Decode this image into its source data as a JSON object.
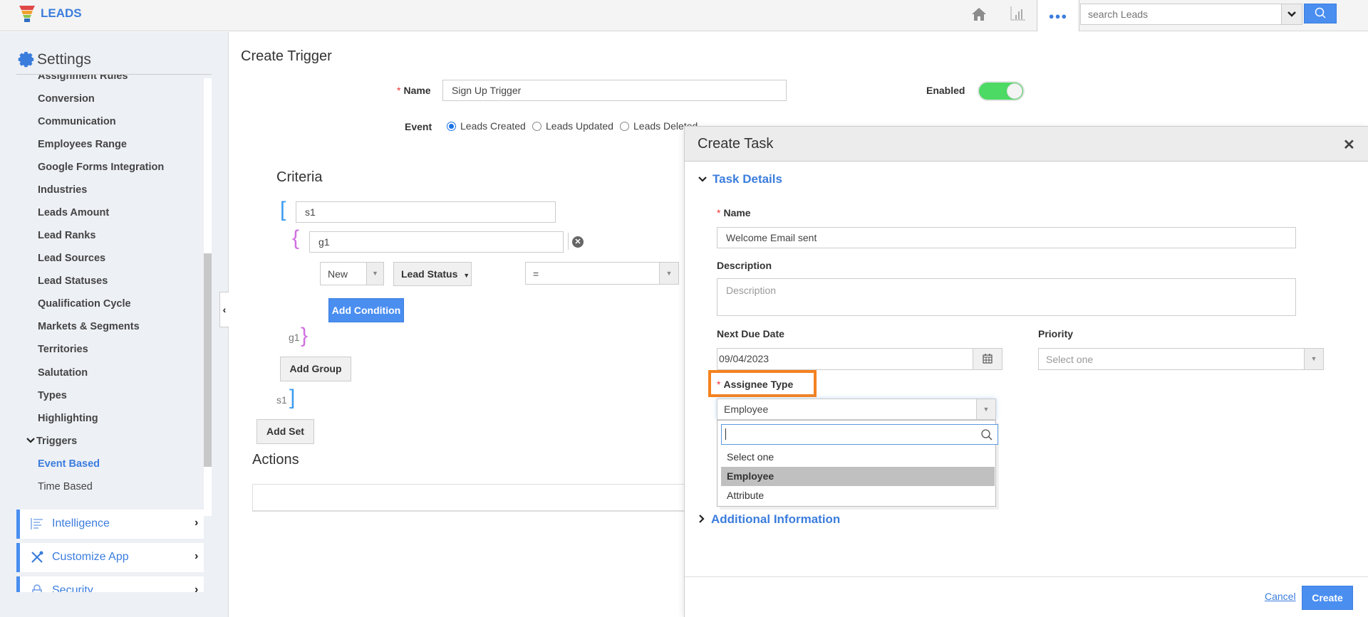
{
  "app": {
    "name": "LEADS",
    "search_placeholder": "search Leads"
  },
  "topbar": {
    "icons": [
      "home-icon",
      "reports-chart-icon",
      "more-dots-icon",
      "search-icon"
    ],
    "more_label": "●●●"
  },
  "sidebar": {
    "title": "Settings",
    "items": [
      {
        "label": "Assignment Rules"
      },
      {
        "label": "Conversion"
      },
      {
        "label": "Communication"
      },
      {
        "label": "Employees Range"
      },
      {
        "label": "Google Forms Integration"
      },
      {
        "label": "Industries"
      },
      {
        "label": "Leads Amount"
      },
      {
        "label": "Lead Ranks"
      },
      {
        "label": "Lead Sources"
      },
      {
        "label": "Lead Statuses"
      },
      {
        "label": "Qualification Cycle"
      },
      {
        "label": "Markets & Segments"
      },
      {
        "label": "Territories"
      },
      {
        "label": "Salutation"
      },
      {
        "label": "Types"
      },
      {
        "label": "Highlighting"
      },
      {
        "label": "Triggers",
        "expanded": true
      },
      {
        "label": "Event Based",
        "active": true
      },
      {
        "label": "Time Based"
      }
    ],
    "groups": [
      {
        "label": "Intelligence",
        "icon": "intelligence-icon"
      },
      {
        "label": "Customize App",
        "icon": "tools-icon"
      },
      {
        "label": "Security",
        "icon": "lock-icon"
      }
    ],
    "collapse_glyph": "‹"
  },
  "trigger_form": {
    "title": "Create Trigger",
    "name_label": "Name",
    "name_value": "Sign Up Trigger",
    "enabled_label": "Enabled",
    "enabled": true,
    "event_label": "Event",
    "events": [
      {
        "label": "Leads Created",
        "selected": true
      },
      {
        "label": "Leads Updated",
        "selected": false
      },
      {
        "label": "Leads Deleted",
        "selected": false
      }
    ],
    "criteria": {
      "title": "Criteria",
      "set_name": "s1",
      "group_name": "g1",
      "condition": {
        "value": "New",
        "field": "Lead Status",
        "operator": "="
      },
      "add_condition_label": "Add Condition",
      "add_group_label": "Add Group",
      "add_set_label": "Add Set",
      "set_close_label": "s1",
      "group_close_label": "g1"
    },
    "actions_title": "Actions"
  },
  "task_modal": {
    "title": "Create Task",
    "close_glyph": "✕",
    "section_task_details": "Task Details",
    "name_label": "Name",
    "name_value": "Welcome Email sent",
    "description_label": "Description",
    "description_placeholder": "Description",
    "due_date_label": "Next Due Date",
    "due_date_value": "09/04/2023",
    "priority_label": "Priority",
    "priority_value": "Select one",
    "assignee_type_label": "Assignee Type",
    "assignee_type_value": "Employee",
    "assignee_options": [
      {
        "label": "Select one",
        "selected": false
      },
      {
        "label": "Employee",
        "selected": true
      },
      {
        "label": "Attribute",
        "selected": false
      }
    ],
    "section_additional": "Additional Information",
    "cancel_label": "Cancel",
    "create_label": "Create"
  },
  "colors": {
    "accent": "#3b7ddd",
    "button_primary": "#4a8ef0",
    "toggle_on": "#4cd964",
    "highlight_box": "#f58220",
    "set_bracket": "#3b9bf0",
    "group_brace": "#d070e0"
  }
}
